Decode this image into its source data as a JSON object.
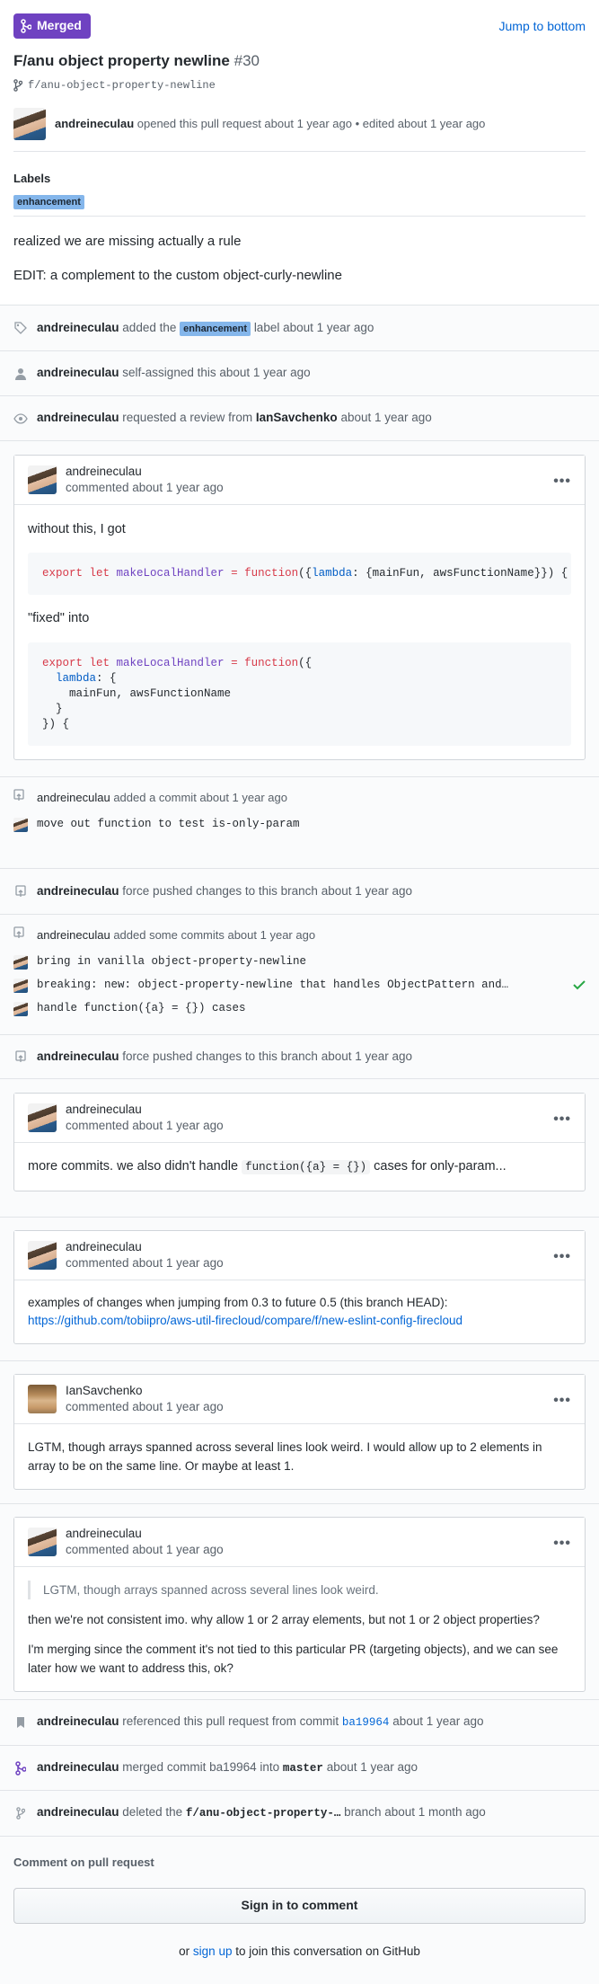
{
  "header": {
    "status": "Merged",
    "jump": "Jump to bottom",
    "title": "F/anu object property newline",
    "number": "#30",
    "branch": "f/anu-object-property-newline",
    "author": "andreineculau",
    "meta": "opened this pull request about 1 year ago • edited about 1 year ago"
  },
  "labels": {
    "heading": "Labels",
    "items": [
      "enhancement"
    ]
  },
  "description": [
    "realized we are missing actually a rule",
    "EDIT: a complement to the custom object-curly-newline"
  ],
  "events": {
    "label": {
      "actor": "andreineculau",
      "pre": "added the",
      "label": "enhancement",
      "post": "label about 1 year ago"
    },
    "assign": {
      "actor": "andreineculau",
      "text": "self-assigned this about 1 year ago"
    },
    "review": {
      "actor": "andreineculau",
      "pre": "requested a review from",
      "target": "IanSavchenko",
      "post": "about 1 year ago"
    },
    "commit1": {
      "actor": "andreineculau",
      "text": "added a commit about 1 year ago",
      "message": "move out function to test is-only-param"
    },
    "force1": {
      "actor": "andreineculau",
      "text": "force pushed changes to this branch about 1 year ago"
    },
    "commits": {
      "actor": "andreineculau",
      "text": "added some commits about 1 year ago",
      "items": [
        "bring in vanilla object-property-newline",
        "breaking: new: object-property-newline that handles ObjectPattern and…",
        "handle function({a} = {}) cases"
      ]
    },
    "force2": {
      "actor": "andreineculau",
      "text": "force pushed changes to this branch about 1 year ago"
    },
    "ref": {
      "actor": "andreineculau",
      "pre": "referenced this pull request from commit",
      "sha": "ba19964",
      "post": "about 1 year ago"
    },
    "merged": {
      "actor": "andreineculau",
      "pre": "merged commit ba19964 into",
      "target": "master",
      "post": "about 1 year ago"
    },
    "deleted": {
      "actor": "andreineculau",
      "pre": "deleted the",
      "branch": "f/anu-object-property-…",
      "post": "branch about 1 month ago"
    }
  },
  "comments": {
    "c1": {
      "author": "andreineculau",
      "time": "commented about 1 year ago",
      "p1": "without this, I got",
      "p2": "\"fixed\" into"
    },
    "c2": {
      "author": "andreineculau",
      "time": "commented about 1 year ago",
      "pre": "more commits. we also didn't handle",
      "code": "function({a} = {})",
      "post": "cases for only-param..."
    },
    "c3": {
      "author": "andreineculau",
      "time": "commented about 1 year ago",
      "text": "examples of changes when jumping from 0.3 to future 0.5 (this branch HEAD):",
      "link": "https://github.com/tobiipro/aws-util-firecloud/compare/f/new-eslint-config-firecloud"
    },
    "c4": {
      "author": "IanSavchenko",
      "time": "commented about 1 year ago",
      "text": "LGTM, though arrays spanned across several lines look weird. I would allow up to 2 elements in array to be on the same line. Or maybe at least 1."
    },
    "c5": {
      "author": "andreineculau",
      "time": "commented about 1 year ago",
      "quote": "LGTM, though arrays spanned across several lines look weird.",
      "p1": "then we're not consistent imo. why allow 1 or 2 array elements, but not 1 or 2 object properties?",
      "p2": "I'm merging since the comment it's not tied to this particular PR (targeting objects), and we can see later how we want to address this, ok?"
    }
  },
  "footer": {
    "heading": "Comment on pull request",
    "button": "Sign in to comment",
    "pre": "or",
    "link": "sign up",
    "post": "to join this conversation on GitHub"
  },
  "colors": {
    "merged": "#6f42c1",
    "link": "#0366d6",
    "label": "#84b6eb",
    "success": "#28a745"
  }
}
